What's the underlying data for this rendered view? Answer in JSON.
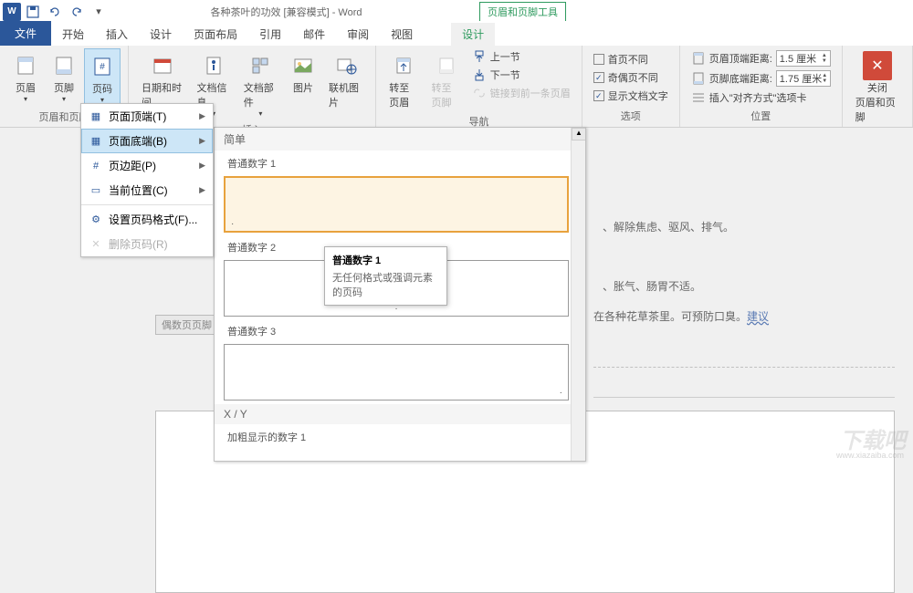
{
  "titlebar": {
    "doc_title": "各种茶叶的功效 [兼容模式] - Word",
    "contextual_tab": "页眉和页脚工具"
  },
  "tabs": {
    "file": "文件",
    "home": "开始",
    "insert": "插入",
    "design": "设计",
    "layout": "页面布局",
    "references": "引用",
    "mail": "邮件",
    "review": "审阅",
    "view": "视图",
    "hf_design": "设计"
  },
  "ribbon": {
    "header": "页眉",
    "footer": "页脚",
    "page_number": "页码",
    "group_hf": "页眉和页脚",
    "datetime": "日期和时间",
    "docinfo": "文档信息",
    "docparts": "文档部件",
    "picture": "图片",
    "online_pic": "联机图片",
    "group_insert": "插入",
    "goto_header": "转至页眉",
    "goto_footer": "转至页脚",
    "prev": "上一节",
    "next": "下一节",
    "link_prev": "链接到前一条页眉",
    "group_nav": "导航",
    "diff_first": "首页不同",
    "diff_oddeven": "奇偶页不同",
    "show_text": "显示文档文字",
    "group_options": "选项",
    "header_top": "页眉顶端距离:",
    "footer_bottom": "页脚底端距离:",
    "header_val": "1.5 厘米",
    "footer_val": "1.75 厘米",
    "insert_align": "插入\"对齐方式\"选项卡",
    "group_position": "位置",
    "close": "关闭",
    "close_hf": "页眉和页脚",
    "group_close": "关闭"
  },
  "dropdown": {
    "top": "页面顶端(T)",
    "bottom": "页面底端(B)",
    "margins": "页边距(P)",
    "current": "当前位置(C)",
    "format": "设置页码格式(F)...",
    "remove": "删除页码(R)"
  },
  "gallery": {
    "header": "简单",
    "item1": "普通数字 1",
    "item2": "普通数字 2",
    "item3": "普通数字 3",
    "section2": "X / Y",
    "item4": "加粗显示的数字 1"
  },
  "tooltip": {
    "title": "普通数字 1",
    "body": "无任何格式或强调元素的页码"
  },
  "document": {
    "line1": "、解除焦虑、驱风、排气。",
    "line2": "、胀气、肠胃不适。",
    "line3": "在各种花草茶里。可预防口臭。",
    "link": "建议",
    "even_footer": "偶数页页脚"
  },
  "watermark": {
    "main": "下载吧",
    "url": "www.xiazaiba.com"
  }
}
